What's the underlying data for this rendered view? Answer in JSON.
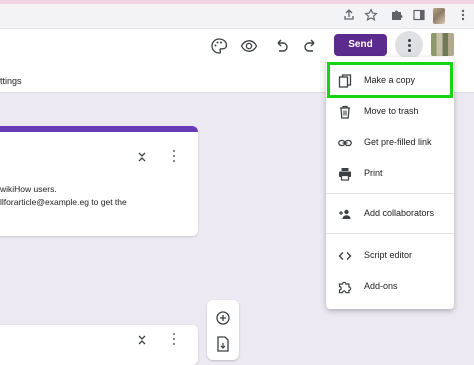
{
  "browser": {
    "icons": [
      "share-icon",
      "star-icon",
      "puzzle-icon",
      "profile-avatar",
      "menu-icon"
    ]
  },
  "toolbar": {
    "icons": [
      "palette-icon",
      "eye-icon",
      "undo-icon",
      "redo-icon"
    ],
    "send_label": "Send"
  },
  "tabs": {
    "settings_partial": "ttings"
  },
  "form_card": {
    "line1": "wikiHow users.",
    "line2": "llforarticle@example.eg to get the"
  },
  "menu": {
    "items": [
      {
        "label": "Make a copy",
        "icon": "copy-icon"
      },
      {
        "label": "Move to trash",
        "icon": "trash-icon"
      },
      {
        "label": "Get pre-filled link",
        "icon": "link-icon"
      },
      {
        "label": "Print",
        "icon": "printer-icon"
      },
      {
        "label": "Add collaborators",
        "icon": "add-people-icon"
      },
      {
        "label": "Script editor",
        "icon": "code-icon"
      },
      {
        "label": "Add-ons",
        "icon": "puzzle-icon"
      }
    ],
    "highlight_color": "#14d414"
  },
  "colors": {
    "accent": "#673ab7",
    "send_button": "#5b2b8d",
    "page_background": "#ece9f3"
  }
}
